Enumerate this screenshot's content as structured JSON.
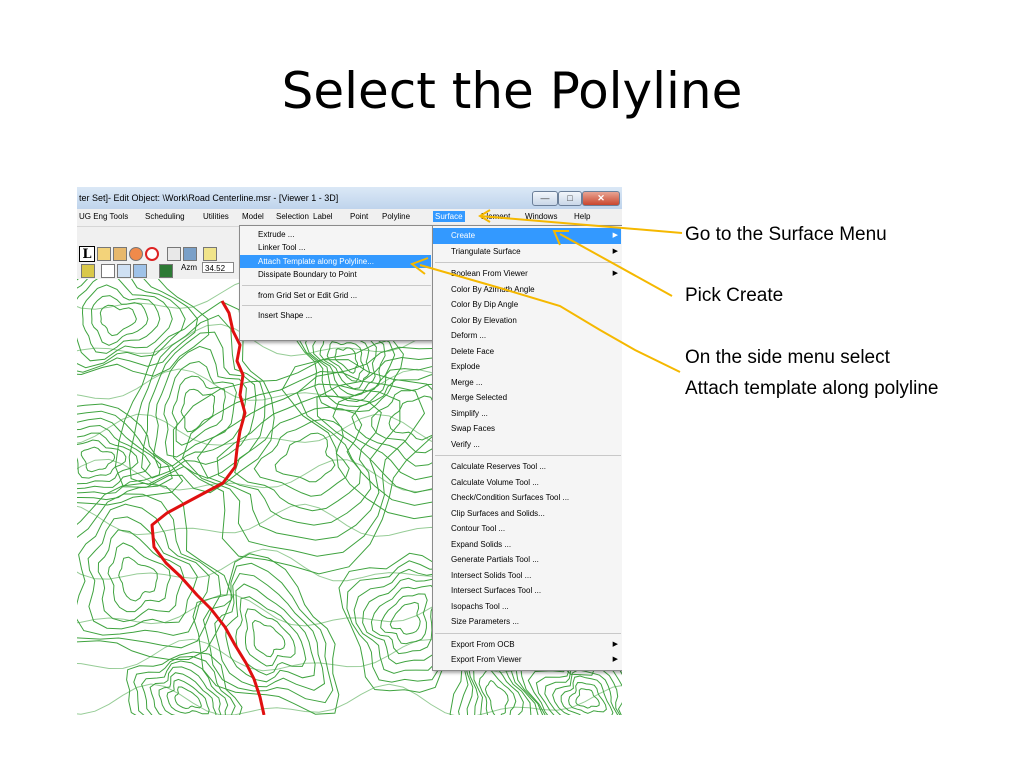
{
  "slide": {
    "title": "Select the Polyline"
  },
  "window": {
    "title": "ter Set]- Edit Object: \\Work\\Road Centerline.msr  - [Viewer 1 - 3D]",
    "buttons": {
      "minimize": "—",
      "maximize": "□",
      "close": "✕"
    }
  },
  "menubar": {
    "items": [
      {
        "label": "UG Eng Tools",
        "name": "menu-ug-eng-tools"
      },
      {
        "label": "Scheduling",
        "name": "menu-scheduling"
      },
      {
        "label": "Utilities",
        "name": "menu-utilities"
      },
      {
        "label": "Model",
        "name": "menu-model"
      },
      {
        "label": "Selection",
        "name": "menu-selection"
      },
      {
        "label": "Label",
        "name": "menu-label"
      },
      {
        "label": "Point",
        "name": "menu-point"
      },
      {
        "label": "Polyline",
        "name": "menu-polyline"
      },
      {
        "label": "Surface",
        "name": "menu-surface",
        "active": true
      },
      {
        "label": "Element",
        "name": "menu-element"
      },
      {
        "label": "Windows",
        "name": "menu-windows"
      },
      {
        "label": "Help",
        "name": "menu-help"
      }
    ]
  },
  "toolbar": {
    "big_label": "L",
    "azm_label": "Azm",
    "azm_value": "34.52"
  },
  "create_submenu": {
    "items": [
      {
        "label": "Extrude ..."
      },
      {
        "label": "Linker Tool ..."
      },
      {
        "label": "Attach Template along Polyline...",
        "highlighted": true
      },
      {
        "label": "Dissipate Boundary to Point"
      },
      {
        "separator": true
      },
      {
        "label": "from Grid Set or Edit Grid ..."
      },
      {
        "separator": true
      },
      {
        "label": "Insert Shape ..."
      }
    ]
  },
  "surface_menu": {
    "items": [
      {
        "label": "Create",
        "highlighted": true,
        "submenu": true
      },
      {
        "label": "Triangulate Surface",
        "submenu": true
      },
      {
        "separator": true
      },
      {
        "label": "Boolean From Viewer",
        "submenu": true
      },
      {
        "label": "Color By Azimuth Angle"
      },
      {
        "label": "Color By Dip Angle"
      },
      {
        "label": "Color By Elevation"
      },
      {
        "label": "Deform ..."
      },
      {
        "label": "Delete Face"
      },
      {
        "label": "Explode"
      },
      {
        "label": "Merge ..."
      },
      {
        "label": "Merge Selected"
      },
      {
        "label": "Simplify ..."
      },
      {
        "label": "Swap Faces"
      },
      {
        "label": "Verify ..."
      },
      {
        "separator": true
      },
      {
        "label": "Calculate Reserves Tool ..."
      },
      {
        "label": "Calculate Volume Tool ..."
      },
      {
        "label": "Check/Condition Surfaces Tool ..."
      },
      {
        "label": "Clip Surfaces and Solids..."
      },
      {
        "label": "Contour Tool ..."
      },
      {
        "label": "Expand Solids ..."
      },
      {
        "label": "Generate Partials Tool ..."
      },
      {
        "label": "Intersect Solids Tool ..."
      },
      {
        "label": "Intersect Surfaces Tool ..."
      },
      {
        "label": "Isopachs Tool ..."
      },
      {
        "label": "Size Parameters ..."
      },
      {
        "separator": true
      },
      {
        "label": "Export From OCB",
        "submenu": true
      },
      {
        "label": "Export From Viewer",
        "submenu": true
      }
    ]
  },
  "callouts": {
    "surface_menu": "Go to the Surface Menu",
    "pick_create": "Pick Create",
    "side_menu_line1": "On the side menu select",
    "side_menu_line2": "Attach template along polyline"
  },
  "colors": {
    "contour": "#3fa33f",
    "polyline": "#e01010",
    "arrow": "#f5b800",
    "menu_highlight": "#3399ff"
  }
}
